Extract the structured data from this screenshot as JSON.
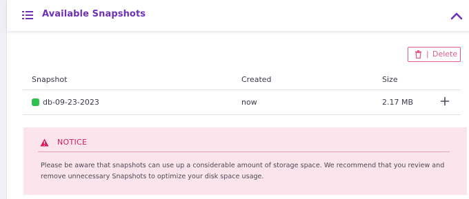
{
  "header": {
    "title": "Available Snapshots",
    "icon": "list-icon",
    "collapse_icon": "chevron-up-icon"
  },
  "toolbar": {
    "delete_separator": "|",
    "delete_label": "Delete",
    "delete_icon": "trash-icon"
  },
  "table": {
    "columns": [
      "Snapshot",
      "Created",
      "Size"
    ],
    "rows": [
      {
        "name": "db-09-23-2023",
        "created": "now",
        "size": "2.17 MB",
        "status_color": "#2fbf4f"
      }
    ]
  },
  "notice": {
    "title": "NOTICE",
    "text": "Please be aware that snapshots can use up a considerable amount of storage space. We recommend that you review and remove unnecessary Snapshots to optimize your disk space usage."
  },
  "colors": {
    "accent": "#6f30b8",
    "danger": "#e05b8a",
    "notice_bg": "#fce4ec",
    "notice_title": "#d81b60"
  }
}
